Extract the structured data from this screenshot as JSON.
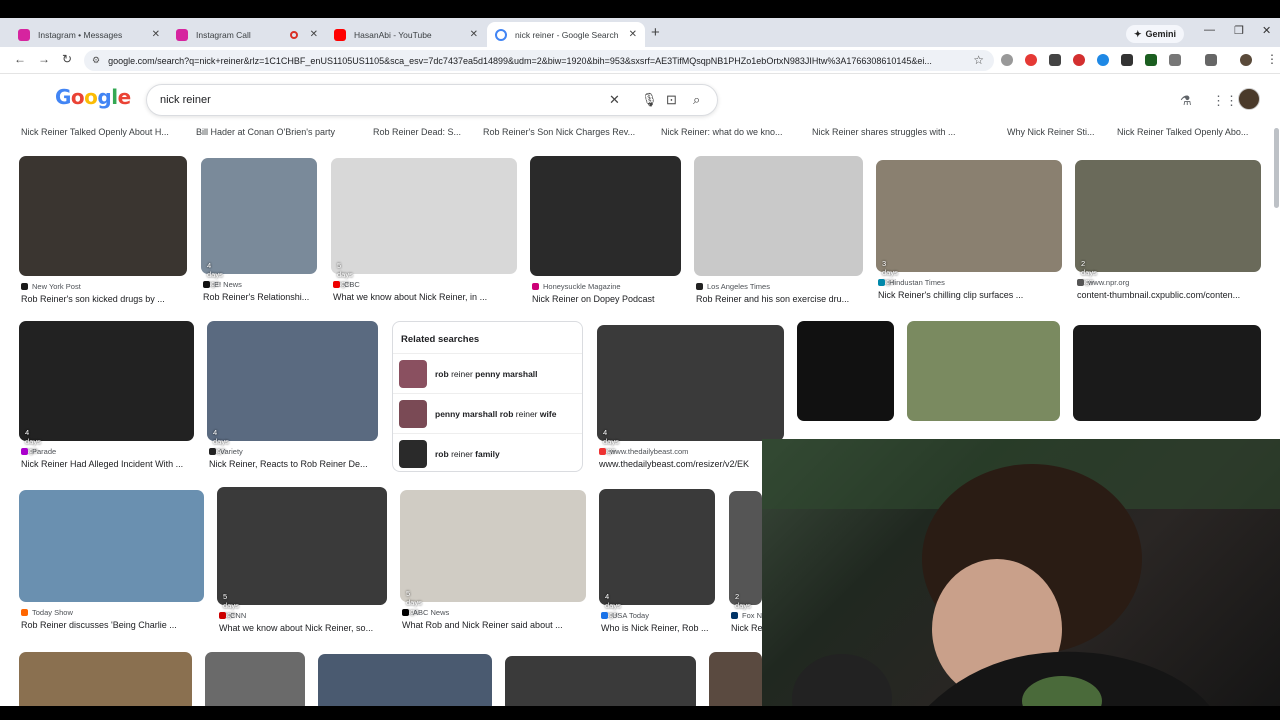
{
  "tabs": [
    {
      "label": "Instagram • Messages",
      "color": "#d6249f"
    },
    {
      "label": "Instagram Call",
      "color": "#d6249f"
    },
    {
      "label": "HasanAbi - YouTube",
      "color": "#ff0000"
    },
    {
      "label": "nick reiner - Google Search",
      "color": "#4285f4"
    }
  ],
  "gemini_label": "Gemini",
  "url": "google.com/search?q=nick+reiner&rlz=1C1CHBF_enUS1105US1105&sca_esv=7dc7437ea5d14899&udm=2&biw=1920&bih=953&sxsrf=AE3TifMQsqpNB1PHZo1ebOrtxN983JIHtw%3A1766308610145&ei...",
  "logo": "Google",
  "search_query": "nick reiner",
  "top_row": [
    "Nick Reiner Talked Openly About H...",
    "Bill Hader at Conan O'Brien's party",
    "Rob Reiner Dead: S...",
    "Rob Reiner's Son Nick Charges Rev...",
    "Nick Reiner: what do we kno...",
    "Nick Reiner shares struggles with ...",
    "Why Nick Reiner Sti...",
    "Nick Reiner Talked Openly Abo..."
  ],
  "results": [
    {
      "src": "New York Post",
      "title": "Rob Reiner's son kicked drugs by ...",
      "ago": "",
      "icon": "#1a1a1a",
      "img": "#3a3530"
    },
    {
      "src": "E! News",
      "title": "Rob Reiner's Relationshi...",
      "ago": "4 days ago",
      "icon": "#111",
      "img": "#7a8a9a"
    },
    {
      "src": "CBC",
      "title": "What we know about Nick Reiner, in ...",
      "ago": "5 days ago",
      "icon": "#e00",
      "img": "#d8d8d8"
    },
    {
      "src": "Honeysuckle Magazine",
      "title": "Nick Reiner on Dopey Podcast",
      "ago": "",
      "icon": "#c07",
      "img": "#2a2a2a"
    },
    {
      "src": "Los Angeles Times",
      "title": "Rob Reiner and his son exercise dru...",
      "ago": "",
      "icon": "#222",
      "img": "#c9c9c9"
    },
    {
      "src": "Hindustan Times",
      "title": "Nick Reiner's chilling clip surfaces ...",
      "ago": "3 days ago",
      "icon": "#08a",
      "img": "#8a8070"
    },
    {
      "src": "www.npr.org",
      "title": "content-thumbnail.cxpublic.com/conten...",
      "ago": "2 days ago",
      "icon": "#555",
      "img": "#6a6a5a"
    },
    {
      "src": "Parade",
      "title": "Nick Reiner Had Alleged Incident With ...",
      "ago": "4 days ago",
      "icon": "#a0c",
      "img": "#222"
    },
    {
      "src": "Variety",
      "title": "Nick Reiner, Reacts to Rob Reiner De...",
      "ago": "4 days ago",
      "icon": "#222",
      "img": "#5a6a80"
    },
    {
      "src": "www.thedailybeast.com",
      "title": "www.thedailybeast.com/resizer/v2/EK",
      "ago": "4 days ago",
      "icon": "#e33",
      "img": "#3a3a3a"
    },
    {
      "src": "Today Show",
      "title": "Rob Reiner discusses 'Being Charlie ...",
      "ago": "",
      "icon": "#f60",
      "img": "#6a90b0"
    },
    {
      "src": "CNN",
      "title": "What we know about Nick Reiner, so...",
      "ago": "5 days ago",
      "icon": "#c00",
      "img": "#3a3a3a"
    },
    {
      "src": "ABC News",
      "title": "What Rob and Nick Reiner said about ...",
      "ago": "5 days ago",
      "icon": "#000",
      "img": "#d0ccc4"
    },
    {
      "src": "USA Today",
      "title": "Who is Nick Reiner, Rob ...",
      "ago": "4 days ago",
      "icon": "#1a73e8",
      "img": "#3a3a3a"
    },
    {
      "src": "Fox N",
      "title": "Nick Re",
      "ago": "2 days",
      "icon": "#036",
      "img": "#555"
    }
  ],
  "related_title": "Related searches",
  "related": [
    {
      "pre": "rob",
      "mid": " reiner ",
      "post": "penny marshall"
    },
    {
      "pre": "penny marshall rob",
      "mid": " reiner ",
      "post": "wife"
    },
    {
      "pre": "rob",
      "mid": " reiner ",
      "post": "family"
    }
  ]
}
